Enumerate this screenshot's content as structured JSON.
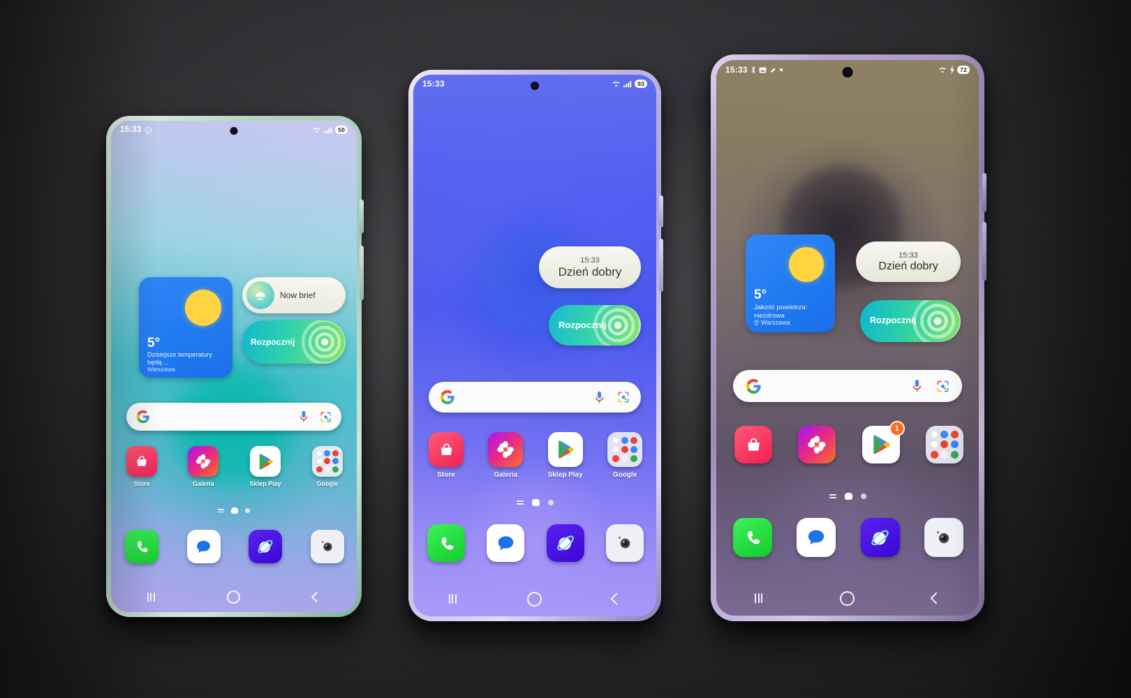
{
  "scene": {
    "description": "Three Samsung Galaxy smartphones lying on a dark grey fabric desk mat, all showing the Polish One UI home screen",
    "surface_color": "#303034"
  },
  "common": {
    "time": "15:33",
    "nav": {
      "recents": "recents",
      "home": "home",
      "back": "back"
    },
    "search": {
      "placeholder": "",
      "logo": "google-g-logo",
      "mic": "mic-icon",
      "lens": "google-lens-icon"
    },
    "dock": [
      {
        "name": "phone",
        "label": "Telefon",
        "color": "#1fd83a"
      },
      {
        "name": "messages",
        "label": "Wiadomości",
        "color": "#ffffff"
      },
      {
        "name": "internet",
        "label": "Internet",
        "color": "#4611e8"
      },
      {
        "name": "camera",
        "label": "Aparat",
        "color": "#eef0f5"
      }
    ],
    "apps": [
      {
        "name": "store",
        "label": "Store",
        "color": "#f5365c"
      },
      {
        "name": "gallery",
        "label": "Galeria",
        "color": "#cc2fcf"
      },
      {
        "name": "play-store",
        "label": "Sklep Play",
        "color": "#ffffff"
      },
      {
        "name": "google-folder",
        "label": "Google",
        "color": "#ecf0f4"
      }
    ]
  },
  "phones": [
    {
      "id": "left",
      "model_hint": "Galaxy S base model, mint green frame",
      "frame_color": "#cfe4d8",
      "statusbar": {
        "time": "15:33",
        "icons": [
          "info-icon",
          "wifi-icon",
          "signal-icon",
          "battery-icon"
        ],
        "battery": "50"
      },
      "weather_widget": {
        "temperature": "5°",
        "description": "Dzisiejsze temperatury będą ...",
        "location": "Warszawa",
        "show_location_pin": false
      },
      "brief_widget": {
        "label": "Now brief",
        "style": "pill-with-icon"
      },
      "start_widget": {
        "label": "Rozpocznij"
      },
      "apps": [
        "Store",
        "Galeria",
        "Sklep Play",
        "Google"
      ],
      "show_app_labels": true,
      "play_badge": null,
      "page_indicator": {
        "lines": true,
        "home": true,
        "dots": 1
      }
    },
    {
      "id": "middle",
      "model_hint": "Galaxy S Plus, light violet frame",
      "frame_color": "#ded5f2",
      "statusbar": {
        "time": "15:33",
        "icons": [
          "wifi-icon",
          "signal-icon",
          "battery-icon"
        ],
        "battery": "93"
      },
      "weather_widget": null,
      "greet_widget": {
        "time": "15:33",
        "message": "Dzień dobry"
      },
      "start_widget": {
        "label": "Rozpocznij"
      },
      "apps": [
        "Store",
        "Galeria",
        "Sklep Play",
        "Google"
      ],
      "show_app_labels": true,
      "play_badge": null,
      "page_indicator": {
        "lines": true,
        "home": true,
        "dots": 1
      }
    },
    {
      "id": "right",
      "model_hint": "Galaxy S Ultra, violet frame",
      "frame_color": "#b9a9cf",
      "statusbar": {
        "time": "15:33",
        "icons": [
          "bluetooth-icon",
          "screenshot-icon",
          "pen-icon",
          "dot-icon",
          "wifi-icon",
          "charging-icon",
          "battery-icon"
        ],
        "battery": "72"
      },
      "weather_widget": {
        "temperature": "5°",
        "description": "Jakość powietrza: niezdrowa",
        "location": "Warszawa",
        "show_location_pin": true
      },
      "greet_widget": {
        "time": "15:33",
        "message": "Dzień dobry"
      },
      "start_widget": {
        "label": "Rozpocznij"
      },
      "apps": [
        "Store",
        "Galeria",
        "Sklep Play",
        "Google"
      ],
      "show_app_labels": false,
      "play_badge": "1",
      "page_indicator": {
        "lines": true,
        "home": true,
        "dots": 1
      }
    }
  ]
}
